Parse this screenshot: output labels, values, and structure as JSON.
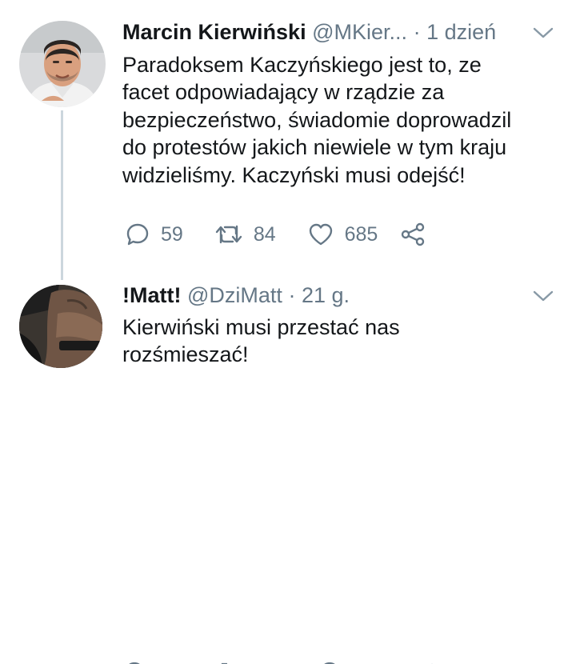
{
  "tweets": [
    {
      "display_name": "Marcin Kierwiński",
      "handle": "@MKier...",
      "separator": "·",
      "time": "1 dzień",
      "text": "Paradoksem Kaczyńskiego jest to, ze\nfacet odpowiadający w rządzie za\nbezpieczeństwo, świadomie doprowadzil\ndo protestów jakich niewiele w tym kraju\nwidzieliśmy. Kaczyński musi odejść!",
      "replies": "59",
      "retweets": "84",
      "likes": "685",
      "icons": [
        "reply-icon",
        "retweet-icon",
        "like-icon",
        "share-icon",
        "chevron-down-icon"
      ]
    },
    {
      "display_name": "!Matt!",
      "handle": "@DziMatt",
      "separator": "·",
      "time": "21 g.",
      "text": "Kierwiński musi przestać nas\nrozśmieszać!",
      "icons": [
        "chevron-down-icon"
      ]
    }
  ],
  "colors": {
    "text": "#14171a",
    "secondary": "#657786",
    "thread_line": "#ccd6dd",
    "background": "#ffffff"
  }
}
